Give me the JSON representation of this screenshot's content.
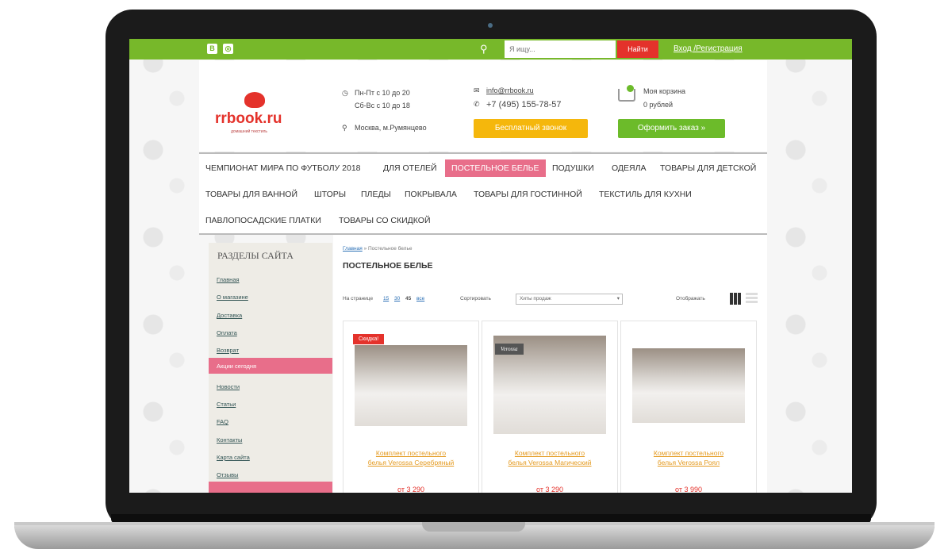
{
  "topbar": {
    "social": [
      "В",
      "◎"
    ],
    "search_placeholder": "Я ищу...",
    "search_button": "Найти",
    "login": "Вход /Регистрация"
  },
  "header": {
    "logo": "rrbook.ru",
    "logo_sub": "домашний текстиль",
    "hours_weekdays": "Пн-Пт с 10 до 20",
    "hours_weekend": "Сб-Вс с 10 до 18",
    "address": "Москва, м.Румянцево",
    "email": "info@rrbook.ru",
    "phone": "+7 (495) 155-78-57",
    "callback_button": "Бесплатный звонок",
    "cart_title": "Моя корзина",
    "cart_total": "0 рублей",
    "checkout_button": "Оформить заказ »"
  },
  "nav": {
    "row1": [
      "ЧЕМПИОНАТ МИРА ПО ФУТБОЛУ 2018",
      "ДЛЯ ОТЕЛЕЙ",
      "ПОСТЕЛЬНОЕ БЕЛЬЕ",
      "ПОДУШКИ",
      "ОДЕЯЛА",
      "ТОВАРЫ ДЛЯ ДЕТСКОЙ"
    ],
    "row2": [
      "ТОВАРЫ ДЛЯ ВАННОЙ",
      "ШТОРЫ",
      "ПЛЕДЫ",
      "ПОКРЫВАЛА",
      "ТОВАРЫ ДЛЯ ГОСТИННОЙ",
      "ТЕКСТИЛЬ ДЛЯ КУХНИ"
    ],
    "row3": [
      "ПАВЛОПОСАДСКИЕ ПЛАТКИ",
      "ТОВАРЫ СО СКИДКОЙ"
    ],
    "active": "ПОСТЕЛЬНОЕ БЕЛЬЕ"
  },
  "sidebar": {
    "title": "РАЗДЕЛЫ САЙТА",
    "items": [
      "Главная",
      "О магазине",
      "Доставка",
      "Оплата",
      "Возврат",
      "Акции сегодня",
      "Новости",
      "Статьи",
      "FAQ",
      "Контакты",
      "Карта сайта",
      "Отзывы"
    ],
    "active": "Акции сегодня"
  },
  "main": {
    "breadcrumb_home": "Главная",
    "breadcrumb_current": "» Постельное белье",
    "title": "ПОСТЕЛЬНОЕ БЕЛЬЕ",
    "per_page_label": "На странице",
    "per_page_options": [
      "15",
      "30",
      "45",
      "все"
    ],
    "sort_label": "Сортировать",
    "sort_value": "Хиты продаж",
    "view_label": "Отображать"
  },
  "products": [
    {
      "name_line1": "Комплект постельного",
      "name_line2": "белья Verossa Серебряный",
      "badge": "Скидка!",
      "price": "от 3 290"
    },
    {
      "name_line1": "Комплект постельного",
      "name_line2": "белья Verossa Магический",
      "badge": "Verossa",
      "price": "от 3 290"
    },
    {
      "name_line1": "Комплект постельного",
      "name_line2": "белья Verossa Роял",
      "badge": "",
      "price": "от 3 990"
    }
  ],
  "colors": {
    "green": "#77b82a",
    "red": "#e4322b",
    "pink": "#e86e8a",
    "orange": "#f5b70c"
  }
}
